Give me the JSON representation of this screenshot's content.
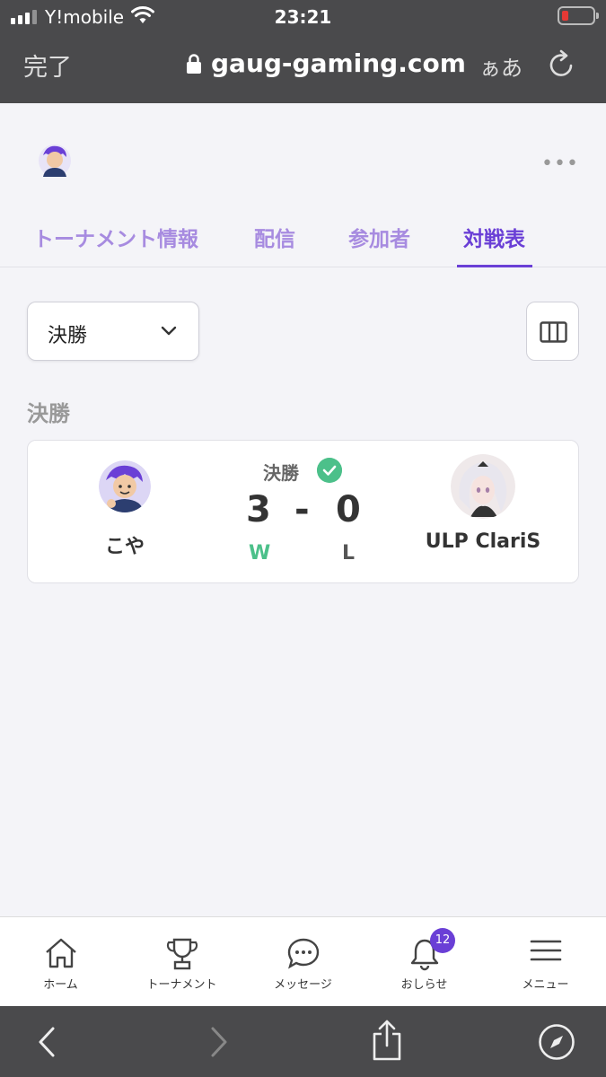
{
  "status_bar": {
    "carrier": "Y!mobile",
    "time": "23:21"
  },
  "browser": {
    "done_label": "完了",
    "url": "gaug-gaming.com",
    "text_size_label": "ぁあ"
  },
  "tabs": [
    {
      "label": "トーナメント情報",
      "active": false
    },
    {
      "label": "配信",
      "active": false
    },
    {
      "label": "参加者",
      "active": false
    },
    {
      "label": "対戦表",
      "active": true
    }
  ],
  "round_select": {
    "value": "決勝"
  },
  "section_title": "決勝",
  "match": {
    "round_label": "決勝",
    "completed": true,
    "player1": {
      "name": "こや",
      "score": "3",
      "result": "W"
    },
    "separator": "-",
    "player2": {
      "name": "ULP ClariS",
      "score": "0",
      "result": "L"
    }
  },
  "bottom_nav": [
    {
      "label": "ホーム",
      "icon": "home-icon"
    },
    {
      "label": "トーナメント",
      "icon": "trophy-icon"
    },
    {
      "label": "メッセージ",
      "icon": "message-icon"
    },
    {
      "label": "おしらせ",
      "icon": "bell-icon",
      "badge": "12"
    },
    {
      "label": "メニュー",
      "icon": "menu-icon"
    }
  ],
  "colors": {
    "accent": "#6a3fd6",
    "tab_inactive": "#a78be0",
    "win": "#4cc08a",
    "browser_chrome": "#4a4a4c"
  }
}
